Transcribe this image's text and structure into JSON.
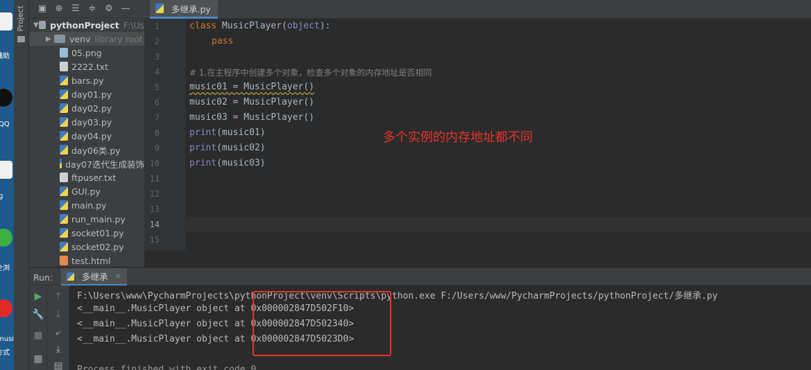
{
  "desktop": {
    "label_1": "捕助",
    "label_2": "QQ",
    "label_3": "g",
    "label_4": "全浏",
    "label_5": "musi",
    "label_6": "方式"
  },
  "side_stripe": {
    "label": "Project"
  },
  "project": {
    "root_name": "pythonProject",
    "root_path": "F:\\Us",
    "venv_name": "venv",
    "venv_hint": "library root",
    "files": [
      {
        "name": "05.png",
        "type": "png"
      },
      {
        "name": "2222.txt",
        "type": "txt"
      },
      {
        "name": "bars.py",
        "type": "py"
      },
      {
        "name": "day01.py",
        "type": "py"
      },
      {
        "name": "day02.py",
        "type": "py"
      },
      {
        "name": "day03.py",
        "type": "py"
      },
      {
        "name": "day04.py",
        "type": "py"
      },
      {
        "name": "day06类.py",
        "type": "py"
      },
      {
        "name": "day07迭代生成装饰",
        "type": "py"
      },
      {
        "name": "ftpuser.txt",
        "type": "txt"
      },
      {
        "name": "GUI.py",
        "type": "py"
      },
      {
        "name": "main.py",
        "type": "py"
      },
      {
        "name": "run_main.py",
        "type": "py"
      },
      {
        "name": "socket01.py",
        "type": "py"
      },
      {
        "name": "socket02.py",
        "type": "py"
      },
      {
        "name": "test.html",
        "type": "html"
      }
    ]
  },
  "editor": {
    "tab_label": "多继承.py",
    "line_numbers": [
      "1",
      "2",
      "3",
      "4",
      "5",
      "6",
      "7",
      "8",
      "9",
      "10",
      "11",
      "12",
      "13",
      "14",
      "15"
    ],
    "lines": {
      "l1_kw": "class",
      "l1_rest": " MusicPlayer(",
      "l1_obj": "object",
      "l1_end": "):",
      "l2": "pass",
      "l4": "# 1.在主程序中创建多个对象，检查多个对象的内存地址是否相同",
      "l5": "music01 = MusicPlayer()",
      "l6": "music02 = MusicPlayer()",
      "l7": "music03 = MusicPlayer()",
      "l8_fn": "print",
      "l8_rest": "(music01)",
      "l9_fn": "print",
      "l9_rest": "(music02)",
      "l10_fn": "print",
      "l10_rest": "(music03)"
    },
    "annotation": "多个实例的内存地址都不同"
  },
  "run": {
    "label": "Run:",
    "tab_label": "多继承",
    "console": [
      "F:\\Users\\www\\PycharmProjects\\pythonProject\\venv\\Scripts\\python.exe F:/Users/www/PycharmProjects/pythonProject/多继承.py",
      "<__main__.MusicPlayer object at 0x000002847D502F10>",
      "<__main__.MusicPlayer object at 0x000002847D502340>",
      "<__main__.MusicPlayer object at 0x000002847D5023D0>",
      "",
      "Process finished with exit code 0"
    ]
  },
  "colors": {
    "annotation_red": "#e8332c",
    "keyword": "#cc7832",
    "builtin": "#8888c6",
    "accent_blue": "#4a88c7"
  }
}
